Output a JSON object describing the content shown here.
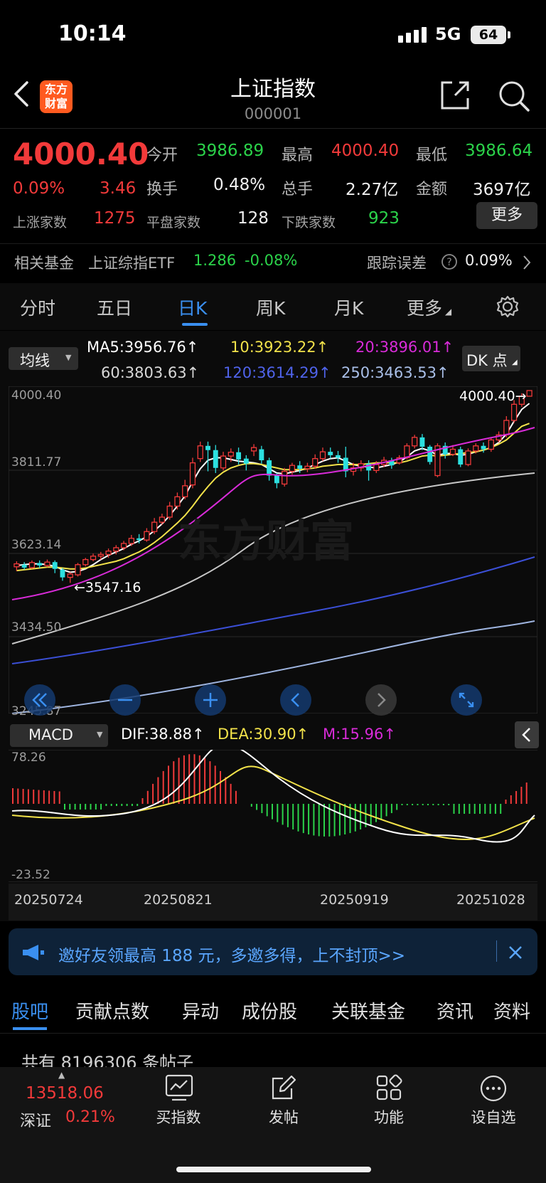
{
  "status": {
    "time": "10:14",
    "network": "5G",
    "battery": "64"
  },
  "header": {
    "brand": "东方\n财富",
    "title": "上证指数",
    "code": "000001"
  },
  "quote": {
    "price": "4000.40",
    "change_pct": "0.09%",
    "change_abs": "3.46",
    "open_label": "今开",
    "open": "3986.89",
    "high_label": "最高",
    "high": "4000.40",
    "low_label": "最低",
    "low": "3986.64",
    "turnover_label": "换手",
    "turnover": "0.48%",
    "volume_label": "总手",
    "volume": "2.27亿",
    "amount_label": "金额",
    "amount": "3697亿",
    "up_label": "上涨家数",
    "up": "1275",
    "flat_label": "平盘家数",
    "flat": "128",
    "down_label": "下跌家数",
    "down": "923",
    "more_label": "更多"
  },
  "fund": {
    "label": "相关基金",
    "name": "上证综指ETF",
    "price": "1.286",
    "change": "-0.08%",
    "tracking_label": "跟踪误差",
    "tracking": "0.09%"
  },
  "tabs": [
    "分时",
    "五日",
    "日K",
    "周K",
    "月K",
    "更多"
  ],
  "active_tab": "日K",
  "ma": {
    "selector": "均线",
    "ma5": "MA5:3956.76",
    "ma10": "10:3923.22",
    "ma20": "20:3896.01",
    "ma60": "60:3803.63",
    "ma120": "120:3614.29",
    "ma250": "250:3463.53",
    "dk_label": "DK 点"
  },
  "colors": {
    "ma5": "#ffffff",
    "ma10": "#f2e24a",
    "ma20": "#d82bd8",
    "ma60": "#c8c8c8",
    "ma120": "#3b4fd6",
    "ma250": "#9fb5e0",
    "up": "#f23a3a",
    "down": "#2ce0e0"
  },
  "price_axis": {
    "labels": [
      "4000.40",
      "3811.77",
      "3623.14",
      "3434.50",
      "3245.87"
    ]
  },
  "annotations": {
    "high": "4000.40",
    "low": "3547.16"
  },
  "macd": {
    "selector": "MACD",
    "dif": "DIF:38.88",
    "dea": "DEA:30.90",
    "m": "M:15.96",
    "axis_top": "78.26",
    "axis_bottom": "-23.52"
  },
  "dates": [
    "20250724",
    "20250821",
    "20250919",
    "20251028"
  ],
  "chart_data": {
    "type": "candlestick",
    "ylim": [
      3245.87,
      4000.4
    ],
    "candles": [
      [
        3585,
        3592,
        3575,
        3598
      ],
      [
        3590,
        3583,
        3578,
        3596
      ],
      [
        3583,
        3595,
        3580,
        3600
      ],
      [
        3594,
        3588,
        3582,
        3600
      ],
      [
        3588,
        3596,
        3584,
        3602
      ],
      [
        3596,
        3580,
        3570,
        3600
      ],
      [
        3578,
        3560,
        3552,
        3582
      ],
      [
        3560,
        3568,
        3547,
        3572
      ],
      [
        3566,
        3590,
        3562,
        3594
      ],
      [
        3590,
        3602,
        3586,
        3606
      ],
      [
        3602,
        3610,
        3598,
        3616
      ],
      [
        3610,
        3614,
        3602,
        3620
      ],
      [
        3614,
        3622,
        3606,
        3628
      ],
      [
        3622,
        3630,
        3614,
        3636
      ],
      [
        3630,
        3640,
        3624,
        3646
      ],
      [
        3640,
        3652,
        3634,
        3660
      ],
      [
        3652,
        3648,
        3640,
        3662
      ],
      [
        3648,
        3668,
        3644,
        3676
      ],
      [
        3668,
        3690,
        3662,
        3700
      ],
      [
        3690,
        3702,
        3684,
        3710
      ],
      [
        3702,
        3728,
        3696,
        3738
      ],
      [
        3728,
        3750,
        3720,
        3760
      ],
      [
        3750,
        3776,
        3744,
        3790
      ],
      [
        3778,
        3830,
        3770,
        3842
      ],
      [
        3840,
        3870,
        3832,
        3880
      ],
      [
        3870,
        3860,
        3810,
        3880
      ],
      [
        3860,
        3818,
        3806,
        3872
      ],
      [
        3818,
        3846,
        3812,
        3856
      ],
      [
        3846,
        3855,
        3832,
        3864
      ],
      [
        3855,
        3838,
        3826,
        3866
      ],
      [
        3840,
        3828,
        3812,
        3848
      ],
      [
        3858,
        3866,
        3846,
        3874
      ],
      [
        3862,
        3836,
        3828,
        3870
      ],
      [
        3836,
        3800,
        3788,
        3842
      ],
      [
        3800,
        3782,
        3770,
        3806
      ],
      [
        3780,
        3810,
        3774,
        3818
      ],
      [
        3810,
        3824,
        3802,
        3830
      ],
      [
        3824,
        3816,
        3806,
        3834
      ],
      [
        3816,
        3822,
        3808,
        3830
      ],
      [
        3822,
        3840,
        3816,
        3850
      ],
      [
        3840,
        3856,
        3834,
        3866
      ],
      [
        3856,
        3848,
        3840,
        3866
      ],
      [
        3848,
        3842,
        3830,
        3858
      ],
      [
        3842,
        3810,
        3796,
        3868
      ],
      [
        3810,
        3818,
        3800,
        3830
      ],
      [
        3818,
        3828,
        3810,
        3836
      ],
      [
        3828,
        3812,
        3788,
        3836
      ],
      [
        3812,
        3826,
        3806,
        3834
      ],
      [
        3826,
        3836,
        3820,
        3844
      ],
      [
        3836,
        3824,
        3816,
        3842
      ],
      [
        3830,
        3842,
        3826,
        3848
      ],
      [
        3842,
        3870,
        3838,
        3876
      ],
      [
        3870,
        3890,
        3864,
        3896
      ],
      [
        3890,
        3868,
        3860,
        3898
      ],
      [
        3868,
        3832,
        3826,
        3872
      ],
      [
        3800,
        3870,
        3796,
        3876
      ],
      [
        3870,
        3850,
        3840,
        3878
      ],
      [
        3850,
        3862,
        3846,
        3872
      ],
      [
        3862,
        3826,
        3820,
        3868
      ],
      [
        3826,
        3858,
        3822,
        3864
      ],
      [
        3858,
        3870,
        3852,
        3876
      ],
      [
        3870,
        3862,
        3854,
        3878
      ],
      [
        3862,
        3884,
        3856,
        3890
      ],
      [
        3884,
        3896,
        3878,
        3904
      ],
      [
        3896,
        3930,
        3890,
        3940
      ],
      [
        3930,
        3968,
        3924,
        3978
      ],
      [
        3968,
        3987,
        3962,
        3994
      ],
      [
        3987,
        4000.4,
        3986.64,
        4000.4
      ]
    ],
    "series": [
      {
        "name": "MA5",
        "values": [
          3588,
          3590,
          3592,
          3592,
          3590,
          3586,
          3578,
          3572,
          3574,
          3580,
          3590,
          3602,
          3612,
          3620,
          3628,
          3638,
          3646,
          3656,
          3670,
          3686,
          3706,
          3728,
          3752,
          3786,
          3816,
          3836,
          3842,
          3842,
          3838,
          3834,
          3832,
          3830,
          3826,
          3816,
          3806,
          3804,
          3808,
          3812,
          3818,
          3826,
          3834,
          3840,
          3842,
          3834,
          3826,
          3822,
          3820,
          3818,
          3822,
          3826,
          3832,
          3844,
          3858,
          3864,
          3858,
          3848,
          3852,
          3852,
          3848,
          3850,
          3856,
          3860,
          3866,
          3878,
          3898,
          3928,
          3956,
          3970
        ]
      },
      {
        "name": "MA10",
        "values": [
          3576,
          3578,
          3580,
          3582,
          3584,
          3584,
          3582,
          3580,
          3580,
          3582,
          3586,
          3590,
          3594,
          3598,
          3604,
          3612,
          3620,
          3630,
          3642,
          3656,
          3672,
          3688,
          3706,
          3728,
          3752,
          3774,
          3794,
          3808,
          3818,
          3824,
          3828,
          3828,
          3826,
          3822,
          3818,
          3814,
          3814,
          3814,
          3816,
          3818,
          3822,
          3824,
          3826,
          3826,
          3826,
          3826,
          3828,
          3830,
          3830,
          3830,
          3830,
          3834,
          3840,
          3846,
          3848,
          3846,
          3848,
          3850,
          3852,
          3854,
          3856,
          3860,
          3866,
          3874,
          3884,
          3900,
          3916,
          3923
        ]
      }
    ]
  }
}
